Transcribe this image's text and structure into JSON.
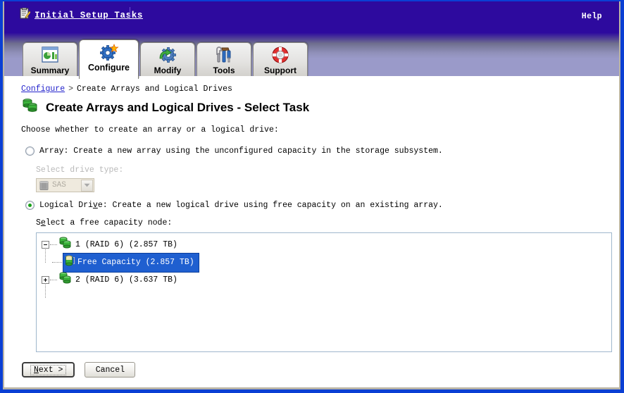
{
  "window": {
    "header": {
      "icon": "clipboard-pencil-icon",
      "title": "Initial Setup Tasks",
      "help_label": "Help",
      "bg_color": "#2d0a9e"
    },
    "tabstrip": {
      "bg_color": "#9a9ac9",
      "tabs": [
        {
          "id": "summary",
          "label": "Summary",
          "icon": "report-chart-icon",
          "active": false
        },
        {
          "id": "configure",
          "label": "Configure",
          "icon": "gear-star-icon",
          "active": true
        },
        {
          "id": "modify",
          "label": "Modify",
          "icon": "gear-arrow-icon",
          "active": false
        },
        {
          "id": "tools",
          "label": "Tools",
          "icon": "tools-icon",
          "active": false
        },
        {
          "id": "support",
          "label": "Support",
          "icon": "life-ring-icon",
          "active": false
        }
      ]
    }
  },
  "breadcrumb": {
    "link": "Configure",
    "separator": ">",
    "current": "Create Arrays and Logical Drives"
  },
  "page": {
    "icon": "database-drives-icon",
    "title": "Create Arrays and Logical Drives - Select Task",
    "instruction": "Choose whether to create an array or a logical drive:"
  },
  "options": {
    "array": {
      "selected": false,
      "enabled": true,
      "label_pre": "Array: Create a new array using the unconfigured capacity in the storage subsystem.",
      "drive_type_label": "Select drive type:",
      "drive_type_value": "SAS",
      "drive_type_enabled": false,
      "drive_type_options": [
        "SAS"
      ]
    },
    "logical_drive": {
      "selected": true,
      "enabled": true,
      "label_a": "Logical Dri",
      "label_mn": "v",
      "label_b": "e: Create a new logical drive using free capacity on an existing array.",
      "tree_label_a": "S",
      "tree_label_mn": "e",
      "tree_label_b": "lect a free capacity node:"
    }
  },
  "tree": {
    "selection_color": "#1f5fd0",
    "nodes": [
      {
        "id": "array-1",
        "icon": "array-icon",
        "label": "1 (RAID 6) (2.857 TB)",
        "expanded": true,
        "selected": false,
        "children": [
          {
            "id": "free-capacity-1",
            "icon": "free-capacity-icon",
            "label": "Free Capacity (2.857 TB)",
            "selected": true
          }
        ]
      },
      {
        "id": "array-2",
        "icon": "array-icon",
        "label": "2 (RAID 6) (3.637 TB)",
        "expanded": false,
        "selected": false,
        "children": []
      }
    ]
  },
  "buttons": {
    "next": {
      "label_mn": "N",
      "label_rest": "ext >",
      "focused": true
    },
    "cancel": {
      "label": "Cancel",
      "focused": false
    }
  }
}
